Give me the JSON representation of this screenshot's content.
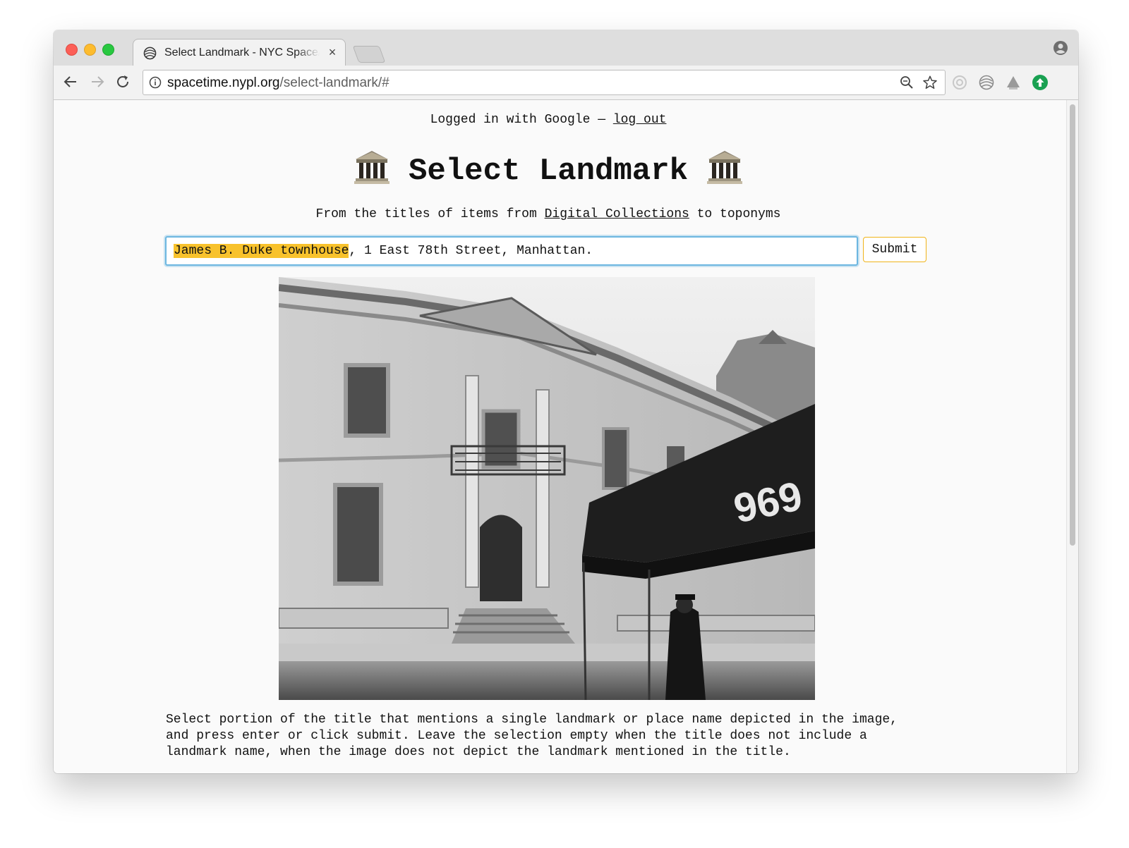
{
  "browser": {
    "tab_title": "Select Landmark - NYC Space/",
    "tab_close": "×",
    "url_host": "spacetime.nypl.org",
    "url_path": "/select-landmark/#"
  },
  "page": {
    "login_text": "Logged in with Google — ",
    "logout_link": "log out",
    "title": "Select Landmark",
    "subtitle_before": "From the titles of items from ",
    "subtitle_link": "Digital Collections",
    "subtitle_after": " to toponyms",
    "input_selected": "James B. Duke townhouse",
    "input_rest": ", 1 East 78th Street, Manhattan.",
    "submit_label": "Submit",
    "photo_awning_number": "969",
    "instructions": "Select portion of the title that mentions a single landmark or place name depicted in the image, and press enter or click submit. Leave the selection empty when the title does not include a landmark name, when the image does not depict the landmark mentioned in the title."
  },
  "colors": {
    "selection_highlight": "#f8c22c",
    "input_focus": "#6cb6e0",
    "submit_border": "#f0b41a"
  },
  "icons": [
    "spacetime-favicon",
    "close-icon",
    "profile-icon",
    "back-arrow-icon",
    "forward-arrow-icon",
    "reload-icon",
    "info-icon",
    "zoom-icon",
    "star-icon",
    "classical-building-icon"
  ]
}
